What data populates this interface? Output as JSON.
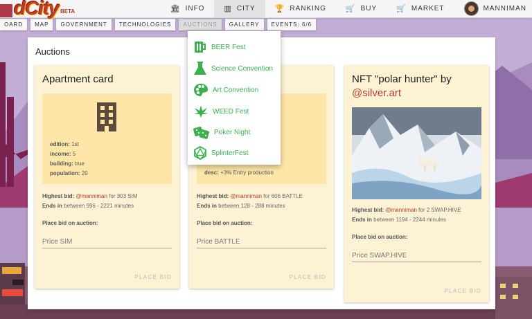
{
  "brand": {
    "name": "dCity",
    "badge": "BETA"
  },
  "topnav": [
    {
      "label": "INFO",
      "icon": "building-columns-icon"
    },
    {
      "label": "CITY",
      "icon": "city-icon",
      "active": true
    },
    {
      "label": "RANKING",
      "icon": "trophy-icon"
    },
    {
      "label": "BUY",
      "icon": "cart-icon"
    },
    {
      "label": "MARKET",
      "icon": "cart-icon"
    }
  ],
  "user": {
    "name": "MANNIMAN"
  },
  "subnav": [
    "OARD",
    "MAP",
    "GOVERNMENT",
    "TECHNOLOGIES",
    "AUCTIONS",
    "GALLERY",
    "EVENTS: 6/6"
  ],
  "panel": {
    "title": "Auctions"
  },
  "cards": {
    "apartment": {
      "title": "Apartment card",
      "props": [
        {
          "key": "edition:",
          "value": "1st"
        },
        {
          "key": "income:",
          "value": "5"
        },
        {
          "key": "building:",
          "value": "true"
        },
        {
          "key": "population:",
          "value": "20"
        }
      ],
      "highest_label": "Highest bid:",
      "highest_user": "@manniman",
      "highest_rest": "for 303 SIM",
      "ends_label": "Ends in",
      "ends_rest": "between 996 - 2221 minutes",
      "place_label": "Place bid on auction:",
      "placeholder": "Price SIM",
      "button": "PLACE BID"
    },
    "middle": {
      "desc_key": "desc:",
      "desc_value": "+3% Entry production",
      "highest_label": "Highest bid:",
      "highest_user": "@manniman",
      "highest_rest": "for 606 BATTLE",
      "ends_label": "Ends in",
      "ends_rest": "between 128 - 288 minutes",
      "place_label": "Place bid on auction:",
      "placeholder": "Price BATTLE",
      "button": "PLACE BID"
    },
    "nft": {
      "title_prefix": "NFT \"polar hunter\" by",
      "title_user": "@silver.art",
      "highest_label": "Highest bid:",
      "highest_user": "@manniman",
      "highest_rest": "for 2 SWAP.HIVE",
      "ends_label": "Ends in",
      "ends_rest": "between 1194 - 2244 minutes",
      "place_label": "Place bid on auction:",
      "placeholder": "Price SWAP.HIVE",
      "button": "PLACE BID"
    }
  },
  "events_menu": [
    {
      "label": "BEER Fest",
      "icon": "beer-mug-icon"
    },
    {
      "label": "Science Convention",
      "icon": "flask-icon"
    },
    {
      "label": "Art Convention",
      "icon": "palette-icon"
    },
    {
      "label": "WEED Fest",
      "icon": "cannabis-leaf-icon"
    },
    {
      "label": "Poker Night",
      "icon": "dice-icon"
    },
    {
      "label": "SplinterFest",
      "icon": "d20-icon"
    }
  ],
  "colors": {
    "accent_green": "#3daf50",
    "user_red": "#c0392b",
    "card_bg": "#fdf3d4",
    "info_bg": "#fde6a8"
  }
}
